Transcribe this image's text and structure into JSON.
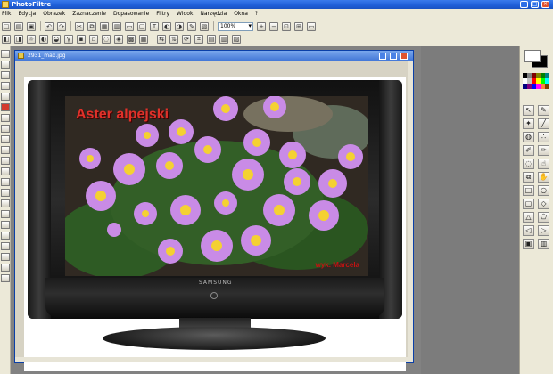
{
  "window": {
    "title": "PhotoFiltre"
  },
  "menubar": [
    "Plik",
    "Edycja",
    "Obrazek",
    "Zaznaczenie",
    "Dopasowanie",
    "Filtry",
    "Widok",
    "Narzędzia",
    "Okna",
    "?"
  ],
  "toolbar": {
    "zoom_value": "100%"
  },
  "document": {
    "title": "2931_max.jpg"
  },
  "image": {
    "title": "Aster alpejski",
    "credit": "wyk. Marcela",
    "brand": "SAMSUNG"
  }
}
